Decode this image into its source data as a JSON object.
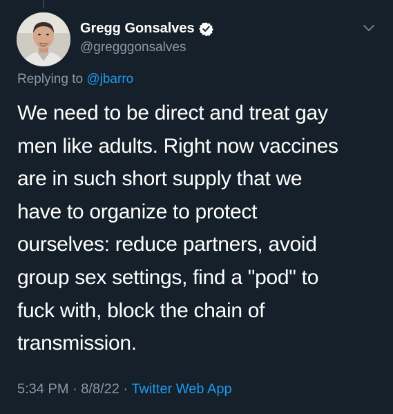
{
  "author": {
    "display_name": "Gregg Gonsalves",
    "handle": "@gregggonsalves",
    "verified": true,
    "avatar_icon": "profile-photo"
  },
  "reply": {
    "prefix": "Replying to",
    "to_handle": "@jbarro"
  },
  "tweet": {
    "text": "We need to be direct and treat gay\nmen like adults. Right now vaccines\nare in such short supply that we\nhave to organize to protect\nourselves: reduce partners, avoid\ngroup sex settings, find a \"pod\" to\nfuck with, block the chain of\ntransmission."
  },
  "meta": {
    "time": "5:34 PM",
    "separator": "·",
    "date": "8/8/22",
    "source": "Twitter Web App"
  },
  "colors": {
    "background": "#15202b",
    "text_primary": "#ffffff",
    "text_secondary": "#8b98a5",
    "accent": "#1d9bf0"
  }
}
